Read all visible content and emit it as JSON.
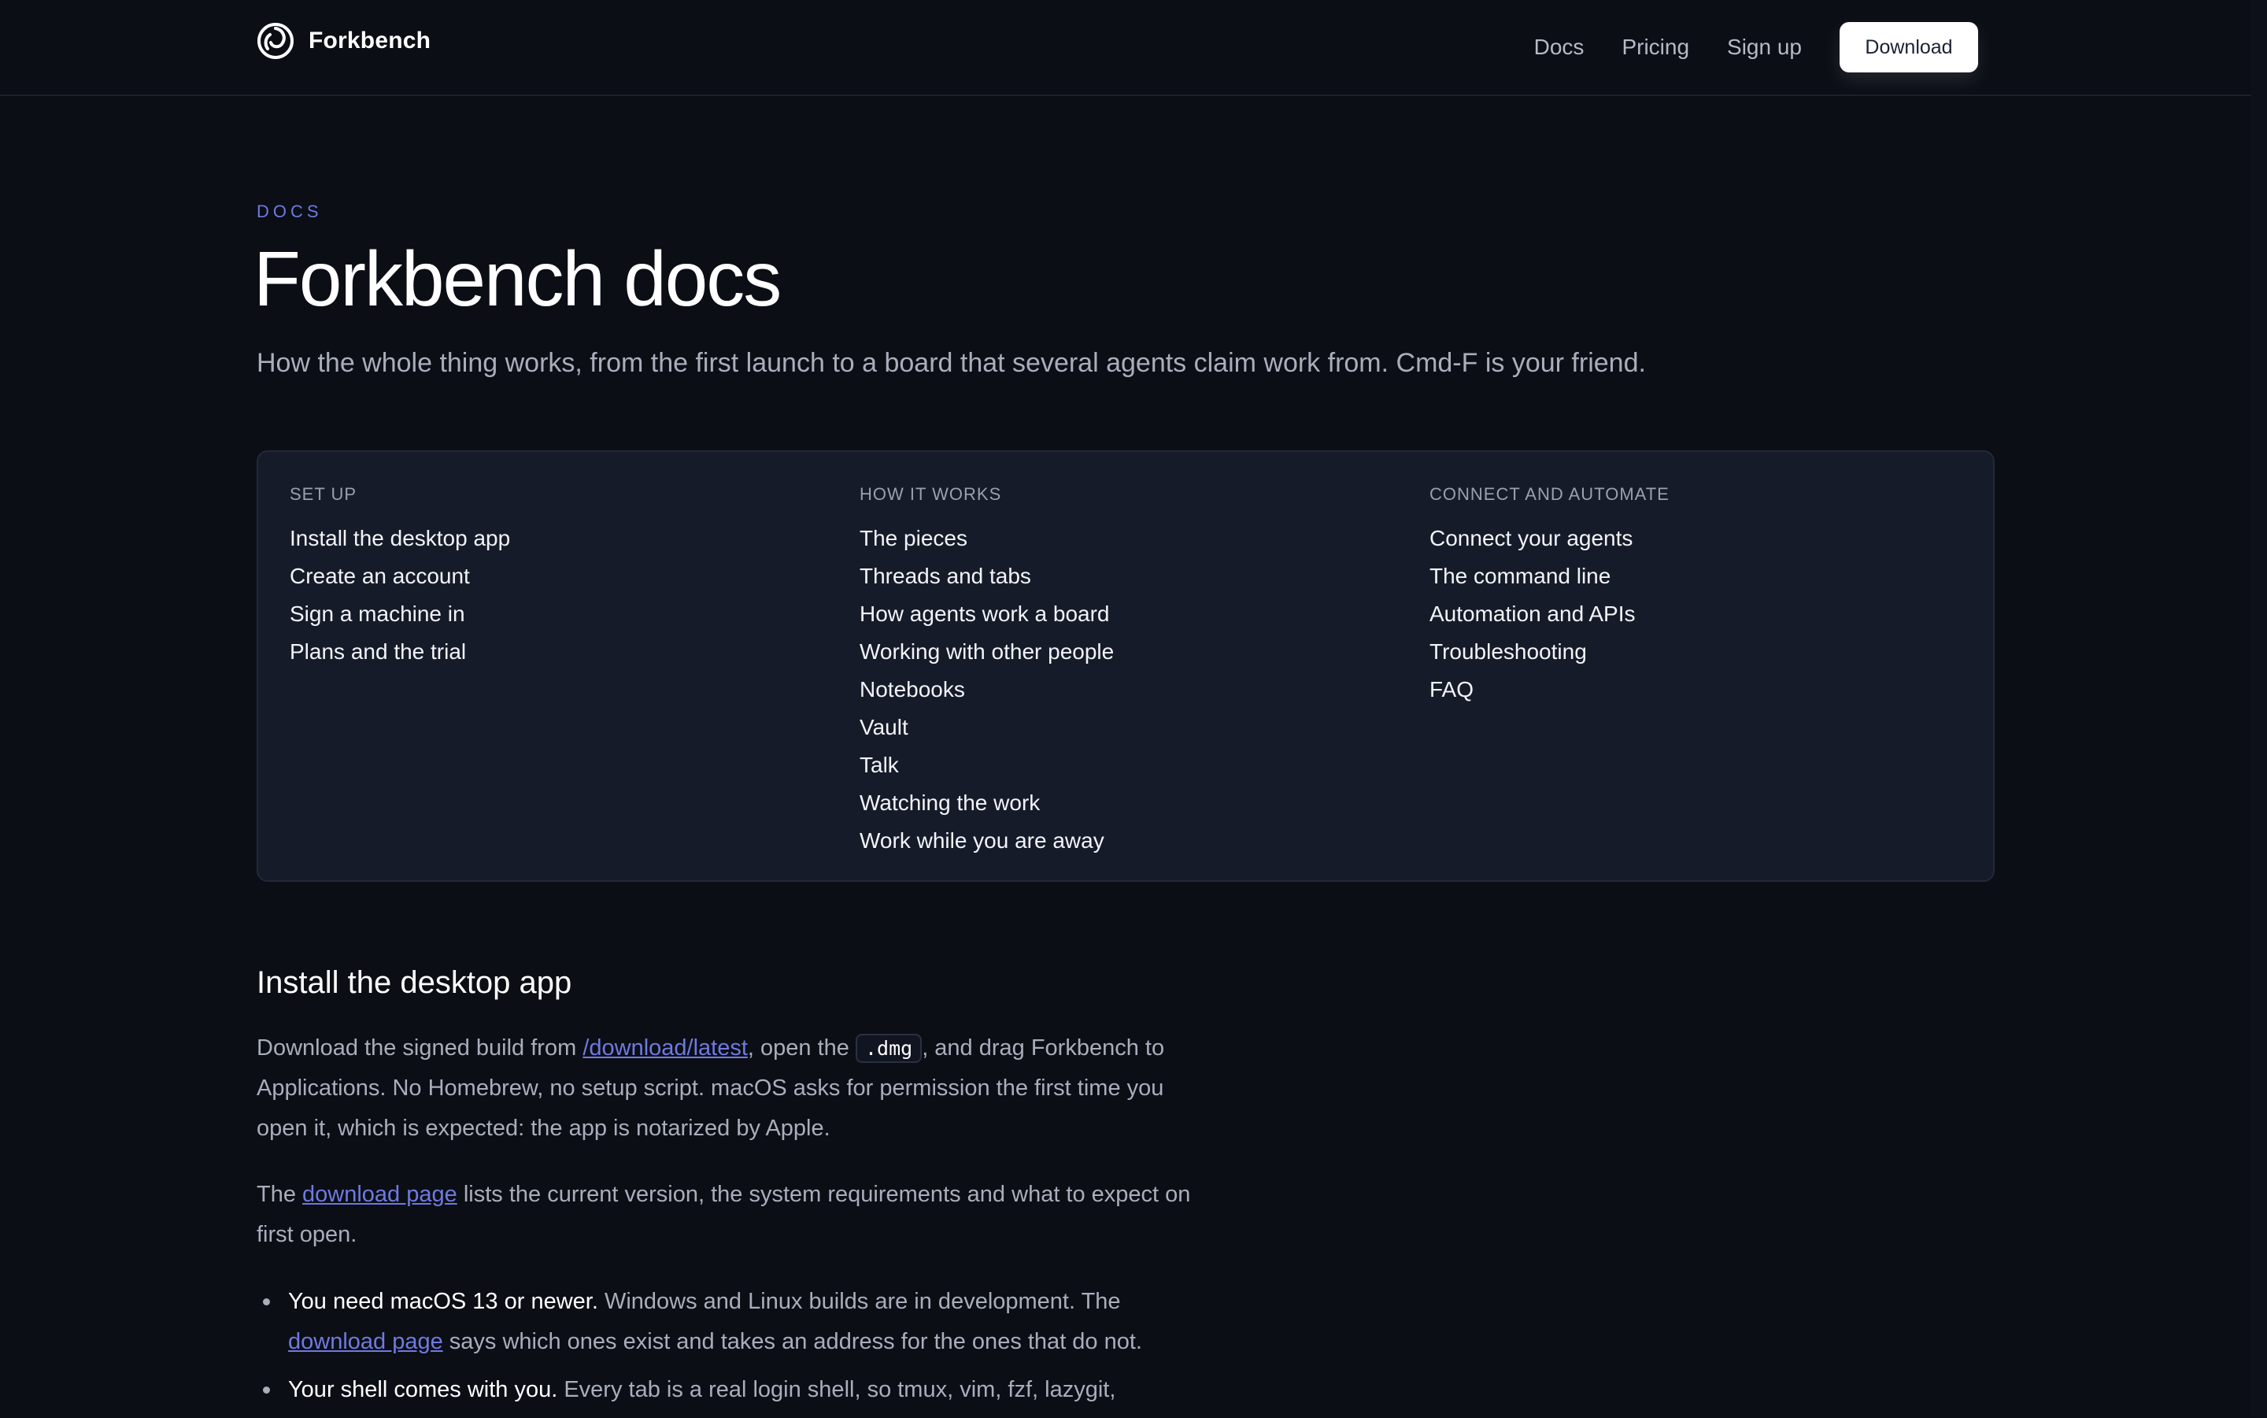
{
  "header": {
    "brand": "Forkbench",
    "nav": [
      "Docs",
      "Pricing",
      "Sign up"
    ],
    "download_label": "Download"
  },
  "intro": {
    "eyebrow": "DOCS",
    "title": "Forkbench docs",
    "lede": "How the whole thing works, from the first launch to a board that several agents claim work from. Cmd-F is your friend."
  },
  "toc": [
    {
      "heading": "SET UP",
      "items": [
        "Install the desktop app",
        "Create an account",
        "Sign a machine in",
        "Plans and the trial"
      ]
    },
    {
      "heading": "HOW IT WORKS",
      "items": [
        "The pieces",
        "Threads and tabs",
        "How agents work a board",
        "Working with other people",
        "Notebooks",
        "Vault",
        "Talk",
        "Watching the work",
        "Work while you are away"
      ]
    },
    {
      "heading": "CONNECT AND AUTOMATE",
      "items": [
        "Connect your agents",
        "The command line",
        "Automation and APIs",
        "Troubleshooting",
        "FAQ"
      ]
    }
  ],
  "install": {
    "title": "Install the desktop app",
    "p1": {
      "before": "Download the signed build from ",
      "link": "/download/latest",
      "middle": ", open the ",
      "code": ".dmg",
      "after": ", and drag Forkbench to Applications. No Homebrew, no setup script. macOS asks for permission the first time you open it, which is expected: the app is notarized by Apple."
    },
    "p2": {
      "before": "The ",
      "link": "download page",
      "after": " lists the current version, the system requirements and what to expect on first open."
    },
    "bullets": [
      {
        "strong": "You need macOS 13 or newer.",
        "text": " Windows and Linux builds are in development. The ",
        "link": "download page",
        "after": " says which ones exist and takes an address for the ones that do not."
      },
      {
        "strong": "Your shell comes with you.",
        "text": " Every tab is a real login shell, so tmux, vim, fzf, lazygit,"
      }
    ]
  },
  "colors": {
    "background": "#0b0e15",
    "card": "#161b2a",
    "accent": "#6f7ae0",
    "text": "#ffffff",
    "muted": "#a9aebb"
  }
}
